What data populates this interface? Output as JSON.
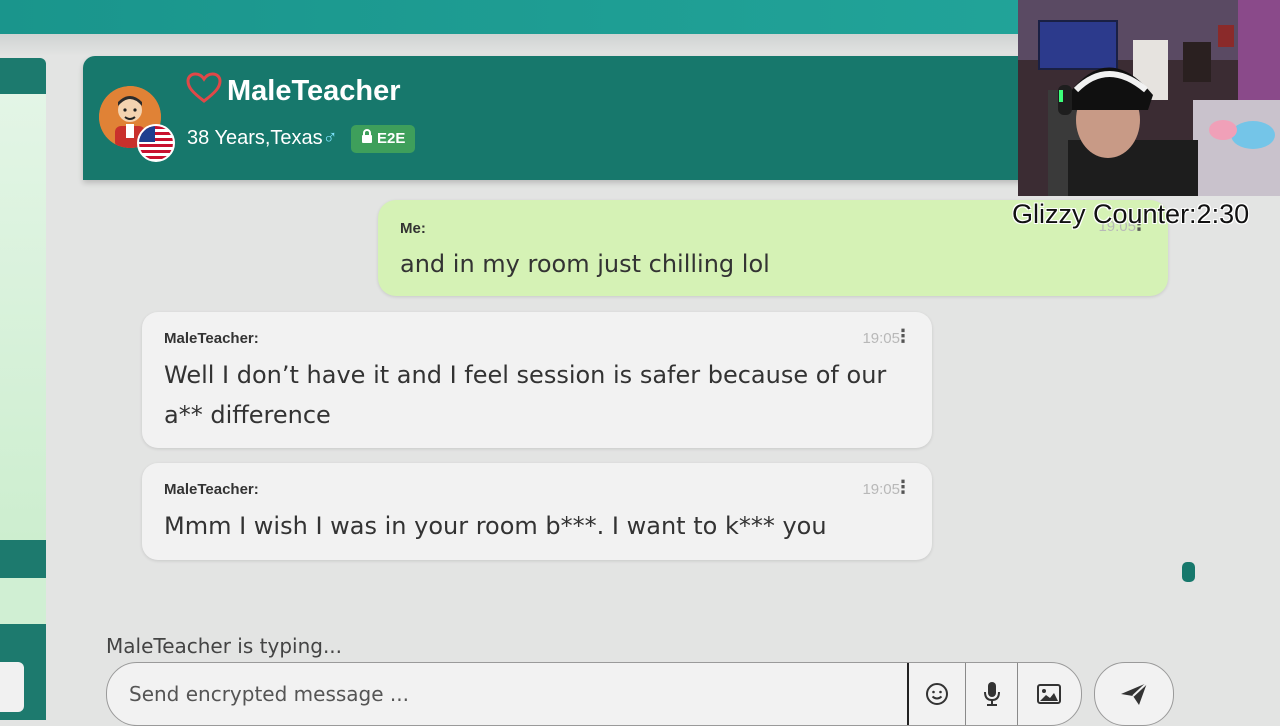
{
  "header": {
    "contact_name": "MaleTeacher",
    "contact_details": "38 Years,Texas",
    "gender_symbol": "♂",
    "encryption_badge": "E2E"
  },
  "messages": [
    {
      "sender": "Me:",
      "text": "and in my room just chilling lol",
      "time": "19:05",
      "direction": "outgoing"
    },
    {
      "sender": "MaleTeacher:",
      "text": "Well I don’t have it and I feel session is safer because of our a** difference",
      "time": "19:05",
      "direction": "incoming"
    },
    {
      "sender": "MaleTeacher:",
      "text": "Mmm I wish I was in your room b***. I want to k*** you",
      "time": "19:05",
      "direction": "incoming"
    }
  ],
  "typing_status": "MaleTeacher is typing...",
  "composer": {
    "placeholder": "Send encrypted message ...",
    "icons": [
      "emoji-icon",
      "microphone-icon",
      "image-icon",
      "send-icon"
    ]
  },
  "overlay": {
    "counter_text": "Glizzy Counter:2:30"
  },
  "colors": {
    "header_bg": "#17786c",
    "outgoing_bubble": "#d5f2b5",
    "incoming_bubble": "#f2f2f2",
    "badge_bg": "#3e9f5b",
    "accent_topbar": "#1a958c"
  }
}
